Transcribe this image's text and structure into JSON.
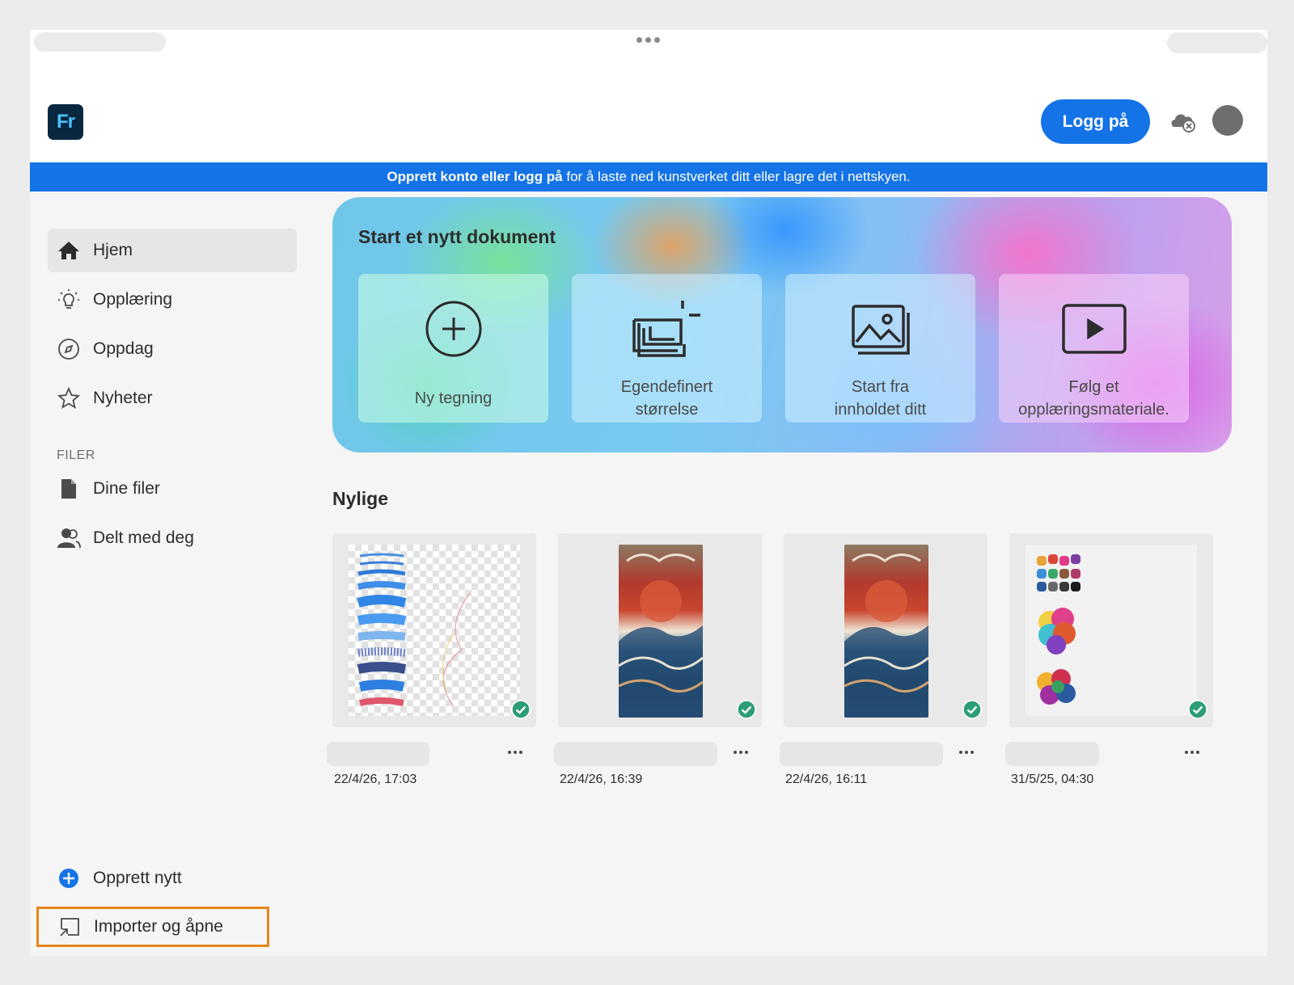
{
  "app": {
    "logo_text": "Fr",
    "login_label": "Logg på"
  },
  "banner": {
    "bold_text": "Opprett konto eller logg på",
    "rest_text": " for å laste ned kunstverket ditt eller lagre det i nettskyen."
  },
  "sidebar": {
    "items": [
      {
        "label": "Hjem",
        "icon": "home-icon"
      },
      {
        "label": "Opplæring",
        "icon": "lightbulb-icon"
      },
      {
        "label": "Oppdag",
        "icon": "compass-icon"
      },
      {
        "label": "Nyheter",
        "icon": "star-icon"
      }
    ],
    "files_heading": "FILER",
    "file_items": [
      {
        "label": "Dine filer",
        "icon": "file-icon"
      },
      {
        "label": "Delt med deg",
        "icon": "shared-user-icon"
      }
    ],
    "create_new": "Opprett nytt",
    "import_open": "Importer og åpne"
  },
  "hero": {
    "title": "Start et nytt dokument",
    "cards": [
      {
        "label": "Ny tegning",
        "icon": "plus-circle-icon"
      },
      {
        "label_line1": "Egendefinert",
        "label_line2": "størrelse",
        "icon": "custom-size-icon"
      },
      {
        "label_line1": "Start fra",
        "label_line2": "innholdet ditt",
        "icon": "image-icon"
      },
      {
        "label_line1": "Følg et",
        "label_line2": "opplæringsmateriale.",
        "icon": "play-video-icon"
      }
    ]
  },
  "recent": {
    "title": "Nylige",
    "items": [
      {
        "date": "22/4/26, 17:03"
      },
      {
        "date": "22/4/26, 16:39"
      },
      {
        "date": "22/4/26, 16:11"
      },
      {
        "date": "31/5/25, 04:30"
      }
    ]
  },
  "colors": {
    "accent": "#1473e6",
    "highlight_outline": "#e68619",
    "synced": "#2d9d78"
  }
}
